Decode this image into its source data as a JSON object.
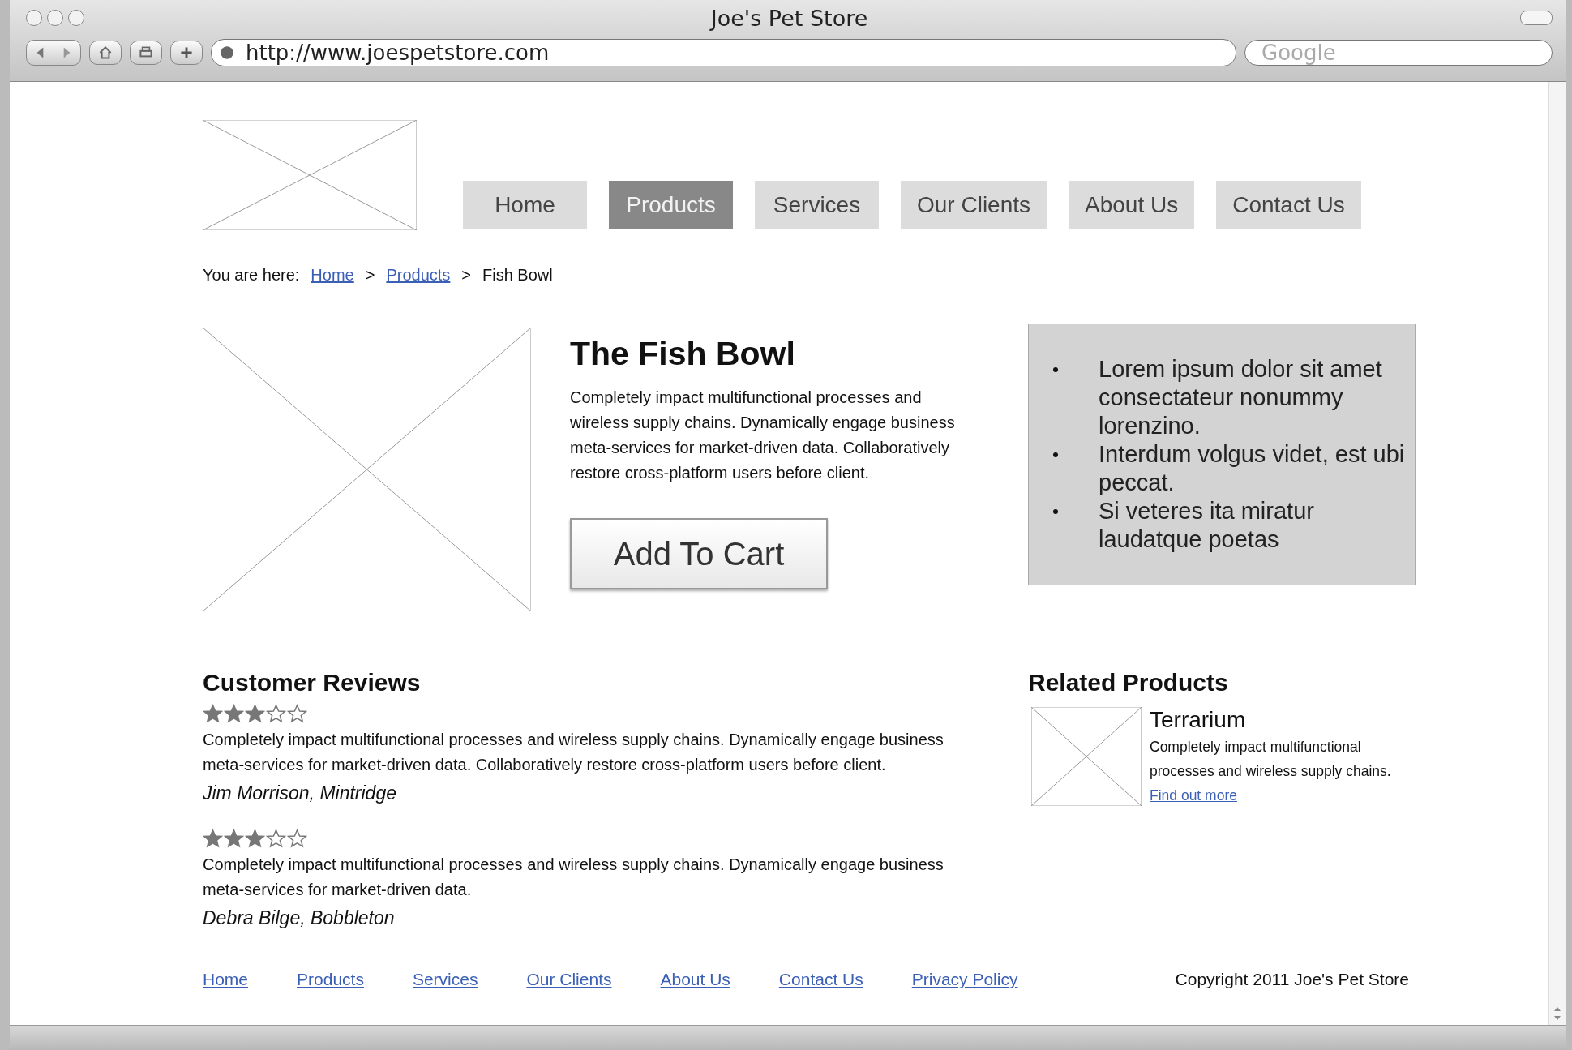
{
  "window": {
    "title": "Joe's Pet Store"
  },
  "address_bar": {
    "url": "http://www.joespetstore.com"
  },
  "search": {
    "placeholder": "Google"
  },
  "nav": [
    {
      "label": "Home",
      "selected": false
    },
    {
      "label": "Products",
      "selected": true
    },
    {
      "label": "Services",
      "selected": false
    },
    {
      "label": "Our Clients",
      "selected": false
    },
    {
      "label": "About Us",
      "selected": false
    },
    {
      "label": "Contact Us",
      "selected": false
    }
  ],
  "breadcrumb": {
    "prefix": "You are here:",
    "links": [
      "Home",
      "Products"
    ],
    "current": "Fish Bowl",
    "separator": ">"
  },
  "product": {
    "title": "The Fish Bowl",
    "description": "Completely impact multifunctional processes and wireless supply chains. Dynamically engage business meta-services for market-driven data. Collaboratively restore cross-platform users before client.",
    "button": "Add To Cart"
  },
  "highlights": [
    "Lorem ipsum dolor sit amet consectateur nonummy lorenzino.",
    "Interdum volgus videt, est ubi peccat.",
    "Si veteres ita miratur laudatque poetas"
  ],
  "reviews_title": "Customer Reviews",
  "reviews": [
    {
      "stars": 3,
      "text": "Completely impact multifunctional processes and wireless supply chains. Dynamically engage business meta-services for market-driven data. Collaboratively restore cross-platform users before client.",
      "author": "Jim Morrison, Mintridge"
    },
    {
      "stars": 3,
      "text": "Completely impact multifunctional processes and wireless supply chains. Dynamically engage business meta-services for market-driven data.",
      "author": "Debra Bilge, Bobbleton"
    }
  ],
  "related_title": "Related Products",
  "related": [
    {
      "name": "Terrarium",
      "text": "Completely impact multifunctional processes and wireless supply chains.",
      "link": "Find out more"
    }
  ],
  "footer": {
    "links": [
      "Home",
      "Products",
      "Services",
      "Our Clients",
      "About Us",
      "Contact Us",
      "Privacy Policy"
    ],
    "copyright": "Copyright 2011 Joe's Pet Store"
  }
}
